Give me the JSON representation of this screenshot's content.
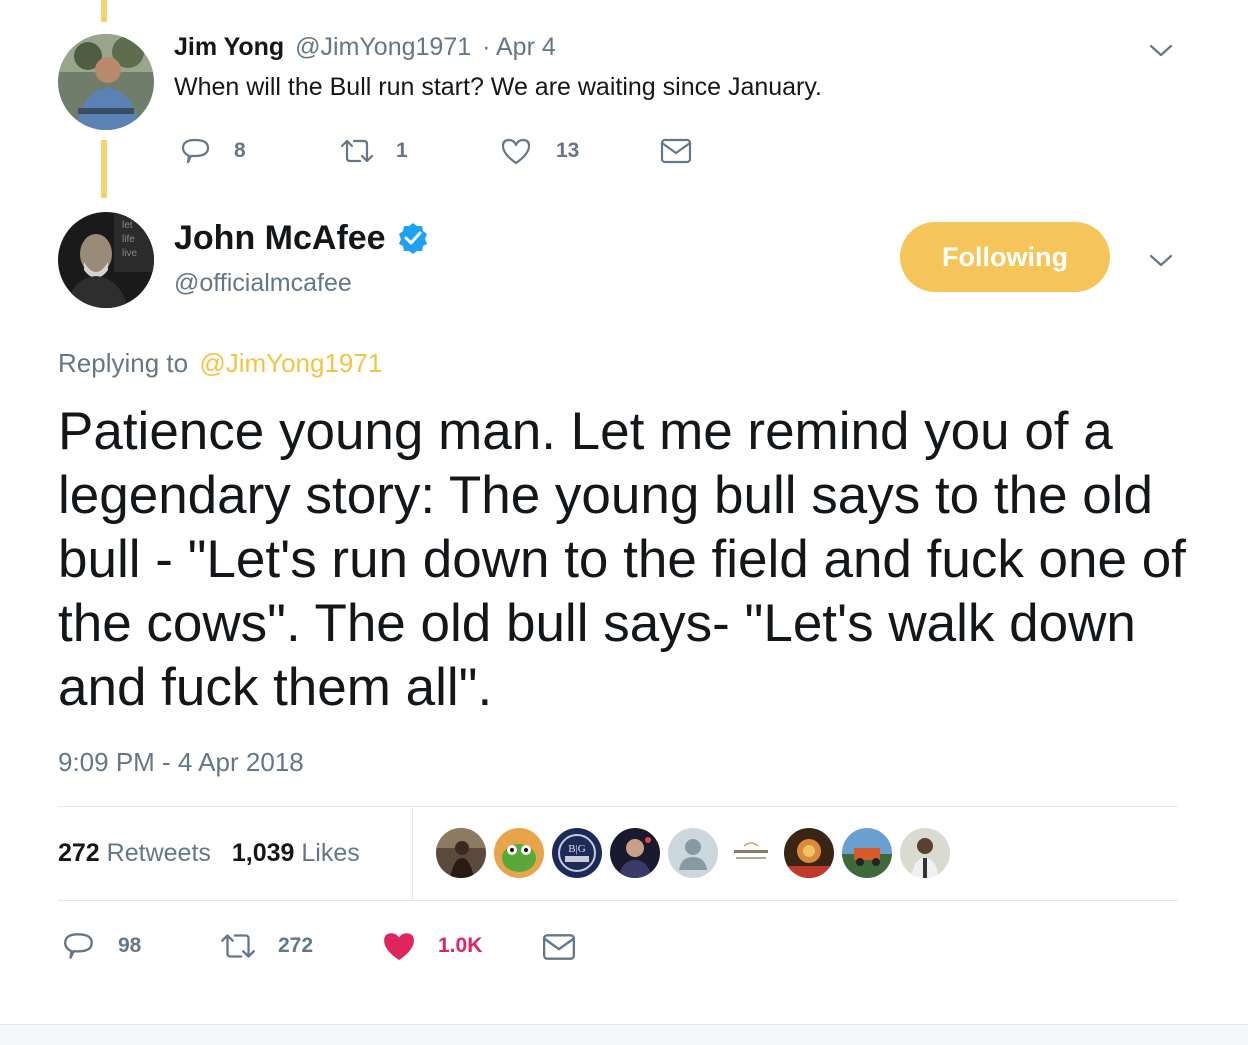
{
  "parent_tweet": {
    "author_name": "Jim Yong",
    "author_handle": "@JimYong1971",
    "date": "· Apr 4",
    "text": "When will the Bull run start? We are waiting since January.",
    "actions": {
      "reply_count": "8",
      "retweet_count": "1",
      "like_count": "13"
    },
    "icons": [
      "reply-icon",
      "retweet-icon",
      "like-icon",
      "message-icon",
      "chevron-down-icon"
    ]
  },
  "main_tweet": {
    "author_name": "John McAfee",
    "author_handle": "@officialmcafee",
    "verified": true,
    "follow_button_label": "Following",
    "replying_to_prefix": "Replying to",
    "replying_to_handle": "@JimYong1971",
    "text": "Patience young man. Let me remind you of a legendary story: The young bull says to the old bull - \"Let's run down to the field and fuck one of the cows\". The old bull says- \"Let's walk down and fuck them all\".",
    "timestamp": "9:09 PM - 4 Apr 2018",
    "stats": {
      "retweets_count": "272",
      "retweets_label": "Retweets",
      "likes_count": "1,039",
      "likes_label": "Likes"
    },
    "actions": {
      "reply_count": "98",
      "retweet_count": "272",
      "like_count": "1.0K"
    },
    "liker_avatars_count": 9
  },
  "colors": {
    "accent": "#f5c343",
    "follow_button": "#f6c55a",
    "thread_line": "#f5d36b",
    "muted_text": "#657786",
    "liked_heart": "#e0245e",
    "verified_badge": "#1da1f2"
  }
}
